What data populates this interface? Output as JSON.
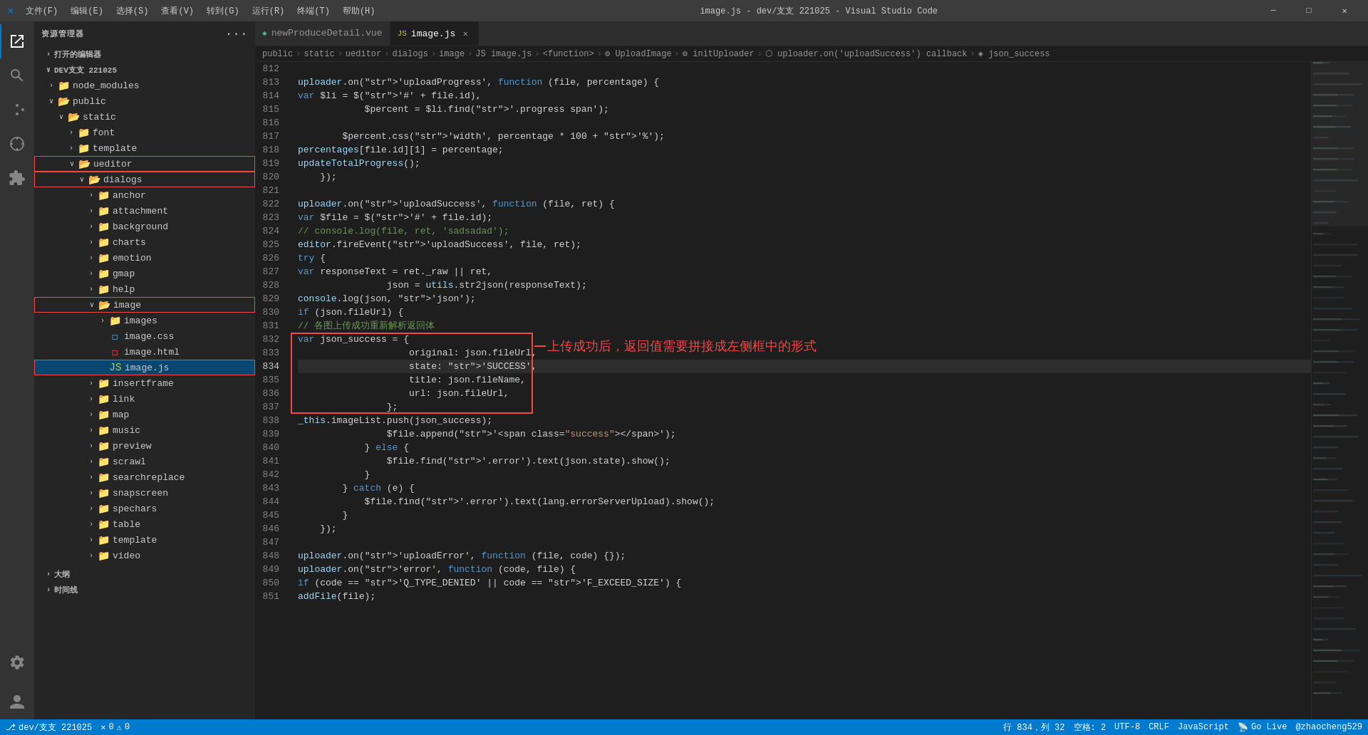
{
  "titlebar": {
    "icon": "X",
    "menus": [
      "文件(F)",
      "编辑(E)",
      "选择(S)",
      "查看(V)",
      "转到(G)",
      "运行(R)",
      "终端(T)",
      "帮助(H)"
    ],
    "title": "image.js - dev/支支 221025 - Visual Studio Code",
    "controls": [
      "─",
      "□",
      "✕"
    ]
  },
  "tabs": [
    {
      "id": "tab-vue",
      "icon": "vue",
      "label": "newProduceDetail.vue",
      "active": false,
      "dirty": false
    },
    {
      "id": "tab-js",
      "icon": "js",
      "label": "image.js",
      "active": true,
      "dirty": false
    }
  ],
  "breadcrumb": [
    "public",
    "static",
    "ueditor",
    "dialogs",
    "image",
    "image.js",
    "<function>",
    "UploadImage",
    "initUploader",
    "uploader.on('uploadSuccess') callback",
    "json_success"
  ],
  "sidebar": {
    "header": "资源管理器",
    "repo": "DEV支支 221025",
    "tree": [
      {
        "id": "open-editors",
        "label": "打开的编辑器",
        "level": 0,
        "type": "section",
        "expanded": false
      },
      {
        "id": "dev",
        "label": "DEV支支 221025",
        "level": 0,
        "type": "folder",
        "expanded": true
      },
      {
        "id": "node_modules",
        "label": "node_modules",
        "level": 1,
        "type": "folder",
        "expanded": false
      },
      {
        "id": "public",
        "label": "public",
        "level": 1,
        "type": "folder",
        "expanded": true
      },
      {
        "id": "static",
        "label": "static",
        "level": 2,
        "type": "folder",
        "expanded": true
      },
      {
        "id": "font",
        "label": "font",
        "level": 3,
        "type": "folder",
        "expanded": false
      },
      {
        "id": "template",
        "label": "template",
        "level": 3,
        "type": "folder",
        "expanded": false
      },
      {
        "id": "ueditor",
        "label": "ueditor",
        "level": 3,
        "type": "folder",
        "expanded": true,
        "highlight": true
      },
      {
        "id": "dialogs",
        "label": "dialogs",
        "level": 4,
        "type": "folder",
        "expanded": true,
        "highlight": true
      },
      {
        "id": "anchor",
        "label": "anchor",
        "level": 5,
        "type": "folder",
        "expanded": false
      },
      {
        "id": "attachment",
        "label": "attachment",
        "level": 5,
        "type": "folder",
        "expanded": false
      },
      {
        "id": "background",
        "label": "background",
        "level": 5,
        "type": "folder",
        "expanded": false
      },
      {
        "id": "charts",
        "label": "charts",
        "level": 5,
        "type": "folder",
        "expanded": false
      },
      {
        "id": "emotion",
        "label": "emotion",
        "level": 5,
        "type": "folder",
        "expanded": false
      },
      {
        "id": "gmap",
        "label": "gmap",
        "level": 5,
        "type": "folder",
        "expanded": false
      },
      {
        "id": "help",
        "label": "help",
        "level": 5,
        "type": "folder",
        "expanded": false
      },
      {
        "id": "image",
        "label": "image",
        "level": 5,
        "type": "folder",
        "expanded": true,
        "highlight": true
      },
      {
        "id": "images",
        "label": "images",
        "level": 6,
        "type": "folder",
        "expanded": false
      },
      {
        "id": "image.css",
        "label": "image.css",
        "level": 6,
        "type": "css"
      },
      {
        "id": "image.html",
        "label": "image.html",
        "level": 6,
        "type": "html"
      },
      {
        "id": "image.js",
        "label": "image.js",
        "level": 6,
        "type": "js",
        "selected": true,
        "highlight": true
      },
      {
        "id": "insertframe",
        "label": "insertframe",
        "level": 5,
        "type": "folder",
        "expanded": false
      },
      {
        "id": "link",
        "label": "link",
        "level": 5,
        "type": "folder",
        "expanded": false
      },
      {
        "id": "map",
        "label": "map",
        "level": 5,
        "type": "folder",
        "expanded": false
      },
      {
        "id": "music",
        "label": "music",
        "level": 5,
        "type": "folder",
        "expanded": false
      },
      {
        "id": "preview",
        "label": "preview",
        "level": 5,
        "type": "folder",
        "expanded": false
      },
      {
        "id": "scrawl",
        "label": "scrawl",
        "level": 5,
        "type": "folder",
        "expanded": false
      },
      {
        "id": "searchreplace",
        "label": "searchreplace",
        "level": 5,
        "type": "folder",
        "expanded": false
      },
      {
        "id": "snapscreen",
        "label": "snapscreen",
        "level": 5,
        "type": "folder",
        "expanded": false
      },
      {
        "id": "spechars",
        "label": "spechars",
        "level": 5,
        "type": "folder",
        "expanded": false
      },
      {
        "id": "table",
        "label": "table",
        "level": 5,
        "type": "folder",
        "expanded": false
      },
      {
        "id": "template2",
        "label": "template",
        "level": 5,
        "type": "folder",
        "expanded": false
      },
      {
        "id": "video",
        "label": "video",
        "level": 5,
        "type": "folder",
        "expanded": false
      }
    ]
  },
  "code": {
    "lines": [
      {
        "num": 812,
        "content": ""
      },
      {
        "num": 813,
        "content": "    uploader.on('uploadProgress', function (file, percentage) {"
      },
      {
        "num": 814,
        "content": "        var $li = $('#' + file.id),"
      },
      {
        "num": 815,
        "content": "            $percent = $li.find('.progress span');"
      },
      {
        "num": 816,
        "content": ""
      },
      {
        "num": 817,
        "content": "        $percent.css('width', percentage * 100 + '%');"
      },
      {
        "num": 818,
        "content": "        percentages[file.id][1] = percentage;"
      },
      {
        "num": 819,
        "content": "        updateTotalProgress();"
      },
      {
        "num": 820,
        "content": "    });"
      },
      {
        "num": 821,
        "content": ""
      },
      {
        "num": 822,
        "content": "    uploader.on('uploadSuccess', function (file, ret) {"
      },
      {
        "num": 823,
        "content": "        var $file = $('#' + file.id);"
      },
      {
        "num": 824,
        "content": "        // console.log(file, ret, 'sadsadad');"
      },
      {
        "num": 825,
        "content": "        editor.fireEvent('uploadSuccess', file, ret);"
      },
      {
        "num": 826,
        "content": "        try {"
      },
      {
        "num": 827,
        "content": "            var responseText = ret._raw || ret,"
      },
      {
        "num": 828,
        "content": "                json = utils.str2json(responseText);"
      },
      {
        "num": 829,
        "content": "            console.log(json, 'json');"
      },
      {
        "num": 830,
        "content": "            if (json.fileUrl) {"
      },
      {
        "num": 831,
        "content": "                // 各图上传成功重新解析返回体"
      },
      {
        "num": 832,
        "content": "                var json_success = {"
      },
      {
        "num": 833,
        "content": "                    original: json.fileUrl,"
      },
      {
        "num": 834,
        "content": "                    state: 'SUCCESS',"
      },
      {
        "num": 835,
        "content": "                    title: json.fileName,"
      },
      {
        "num": 836,
        "content": "                    url: json.fileUrl,"
      },
      {
        "num": 837,
        "content": "                };"
      },
      {
        "num": 838,
        "content": "                _this.imageList.push(json_success);"
      },
      {
        "num": 839,
        "content": "                $file.append('<span class=\"success\"></span>');"
      },
      {
        "num": 840,
        "content": "            } else {"
      },
      {
        "num": 841,
        "content": "                $file.find('.error').text(json.state).show();"
      },
      {
        "num": 842,
        "content": "            }"
      },
      {
        "num": 843,
        "content": "        } catch (e) {"
      },
      {
        "num": 844,
        "content": "            $file.find('.error').text(lang.errorServerUpload).show();"
      },
      {
        "num": 845,
        "content": "        }"
      },
      {
        "num": 846,
        "content": "    });"
      },
      {
        "num": 847,
        "content": ""
      },
      {
        "num": 848,
        "content": "    uploader.on('uploadError', function (file, code) {});"
      },
      {
        "num": 849,
        "content": "    uploader.on('error', function (code, file) {"
      },
      {
        "num": 850,
        "content": "        if (code == 'Q_TYPE_DENIED' || code == 'F_EXCEED_SIZE') {"
      },
      {
        "num": 851,
        "content": "            addFile(file);"
      }
    ]
  },
  "annotation": {
    "text": "上传成功后，返回值需要拼接成左侧框中的形式"
  },
  "statusbar": {
    "left": {
      "errors": "0",
      "warnings": "0",
      "branch": "dev/支支 221025"
    },
    "right": {
      "position": "行 834，列 32",
      "spaces": "空格: 2",
      "encoding": "UTF-8",
      "eol": "CRLF",
      "language": "JavaScript",
      "golive": "Go Live",
      "user": "@zhaocheng529"
    }
  }
}
